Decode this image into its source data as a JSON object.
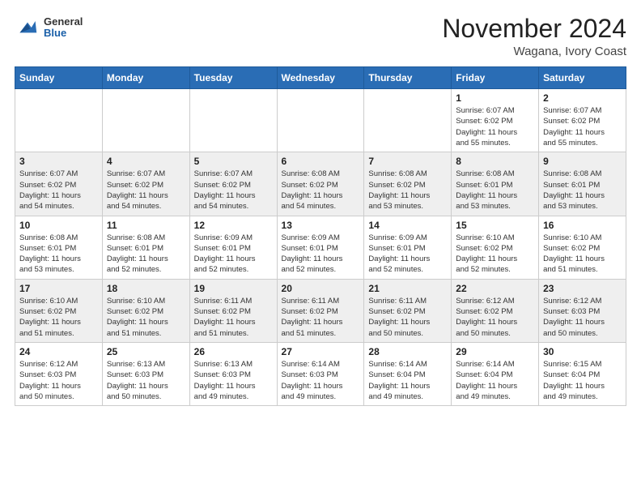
{
  "header": {
    "logo": {
      "general": "General",
      "blue": "Blue"
    },
    "month": "November 2024",
    "location": "Wagana, Ivory Coast"
  },
  "weekdays": [
    "Sunday",
    "Monday",
    "Tuesday",
    "Wednesday",
    "Thursday",
    "Friday",
    "Saturday"
  ],
  "weeks": [
    [
      {
        "day": "",
        "info": ""
      },
      {
        "day": "",
        "info": ""
      },
      {
        "day": "",
        "info": ""
      },
      {
        "day": "",
        "info": ""
      },
      {
        "day": "",
        "info": ""
      },
      {
        "day": "1",
        "info": "Sunrise: 6:07 AM\nSunset: 6:02 PM\nDaylight: 11 hours\nand 55 minutes."
      },
      {
        "day": "2",
        "info": "Sunrise: 6:07 AM\nSunset: 6:02 PM\nDaylight: 11 hours\nand 55 minutes."
      }
    ],
    [
      {
        "day": "3",
        "info": "Sunrise: 6:07 AM\nSunset: 6:02 PM\nDaylight: 11 hours\nand 54 minutes."
      },
      {
        "day": "4",
        "info": "Sunrise: 6:07 AM\nSunset: 6:02 PM\nDaylight: 11 hours\nand 54 minutes."
      },
      {
        "day": "5",
        "info": "Sunrise: 6:07 AM\nSunset: 6:02 PM\nDaylight: 11 hours\nand 54 minutes."
      },
      {
        "day": "6",
        "info": "Sunrise: 6:08 AM\nSunset: 6:02 PM\nDaylight: 11 hours\nand 54 minutes."
      },
      {
        "day": "7",
        "info": "Sunrise: 6:08 AM\nSunset: 6:02 PM\nDaylight: 11 hours\nand 53 minutes."
      },
      {
        "day": "8",
        "info": "Sunrise: 6:08 AM\nSunset: 6:01 PM\nDaylight: 11 hours\nand 53 minutes."
      },
      {
        "day": "9",
        "info": "Sunrise: 6:08 AM\nSunset: 6:01 PM\nDaylight: 11 hours\nand 53 minutes."
      }
    ],
    [
      {
        "day": "10",
        "info": "Sunrise: 6:08 AM\nSunset: 6:01 PM\nDaylight: 11 hours\nand 53 minutes."
      },
      {
        "day": "11",
        "info": "Sunrise: 6:08 AM\nSunset: 6:01 PM\nDaylight: 11 hours\nand 52 minutes."
      },
      {
        "day": "12",
        "info": "Sunrise: 6:09 AM\nSunset: 6:01 PM\nDaylight: 11 hours\nand 52 minutes."
      },
      {
        "day": "13",
        "info": "Sunrise: 6:09 AM\nSunset: 6:01 PM\nDaylight: 11 hours\nand 52 minutes."
      },
      {
        "day": "14",
        "info": "Sunrise: 6:09 AM\nSunset: 6:01 PM\nDaylight: 11 hours\nand 52 minutes."
      },
      {
        "day": "15",
        "info": "Sunrise: 6:10 AM\nSunset: 6:02 PM\nDaylight: 11 hours\nand 52 minutes."
      },
      {
        "day": "16",
        "info": "Sunrise: 6:10 AM\nSunset: 6:02 PM\nDaylight: 11 hours\nand 51 minutes."
      }
    ],
    [
      {
        "day": "17",
        "info": "Sunrise: 6:10 AM\nSunset: 6:02 PM\nDaylight: 11 hours\nand 51 minutes."
      },
      {
        "day": "18",
        "info": "Sunrise: 6:10 AM\nSunset: 6:02 PM\nDaylight: 11 hours\nand 51 minutes."
      },
      {
        "day": "19",
        "info": "Sunrise: 6:11 AM\nSunset: 6:02 PM\nDaylight: 11 hours\nand 51 minutes."
      },
      {
        "day": "20",
        "info": "Sunrise: 6:11 AM\nSunset: 6:02 PM\nDaylight: 11 hours\nand 51 minutes."
      },
      {
        "day": "21",
        "info": "Sunrise: 6:11 AM\nSunset: 6:02 PM\nDaylight: 11 hours\nand 50 minutes."
      },
      {
        "day": "22",
        "info": "Sunrise: 6:12 AM\nSunset: 6:02 PM\nDaylight: 11 hours\nand 50 minutes."
      },
      {
        "day": "23",
        "info": "Sunrise: 6:12 AM\nSunset: 6:03 PM\nDaylight: 11 hours\nand 50 minutes."
      }
    ],
    [
      {
        "day": "24",
        "info": "Sunrise: 6:12 AM\nSunset: 6:03 PM\nDaylight: 11 hours\nand 50 minutes."
      },
      {
        "day": "25",
        "info": "Sunrise: 6:13 AM\nSunset: 6:03 PM\nDaylight: 11 hours\nand 50 minutes."
      },
      {
        "day": "26",
        "info": "Sunrise: 6:13 AM\nSunset: 6:03 PM\nDaylight: 11 hours\nand 49 minutes."
      },
      {
        "day": "27",
        "info": "Sunrise: 6:14 AM\nSunset: 6:03 PM\nDaylight: 11 hours\nand 49 minutes."
      },
      {
        "day": "28",
        "info": "Sunrise: 6:14 AM\nSunset: 6:04 PM\nDaylight: 11 hours\nand 49 minutes."
      },
      {
        "day": "29",
        "info": "Sunrise: 6:14 AM\nSunset: 6:04 PM\nDaylight: 11 hours\nand 49 minutes."
      },
      {
        "day": "30",
        "info": "Sunrise: 6:15 AM\nSunset: 6:04 PM\nDaylight: 11 hours\nand 49 minutes."
      }
    ]
  ]
}
